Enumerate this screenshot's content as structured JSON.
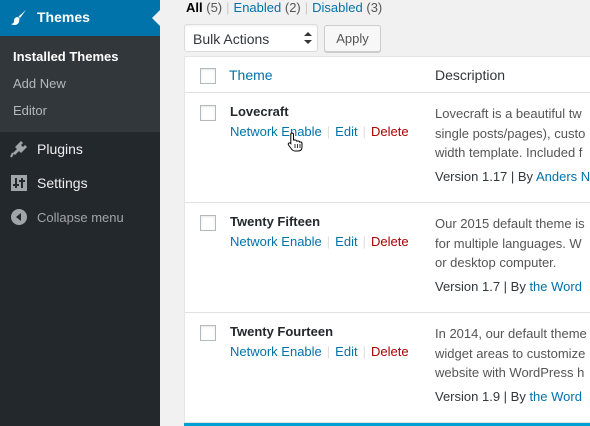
{
  "sidebar": {
    "active_menu": {
      "label": "Themes",
      "icon": "paintbrush-icon"
    },
    "submenu": [
      {
        "label": "Installed Themes",
        "current": true
      },
      {
        "label": "Add New",
        "current": false
      },
      {
        "label": "Editor",
        "current": false
      }
    ],
    "menu": [
      {
        "label": "Plugins",
        "icon": "plugin-icon"
      },
      {
        "label": "Settings",
        "icon": "settings-icon"
      },
      {
        "label": "Collapse menu",
        "icon": "collapse-icon"
      }
    ]
  },
  "filters": {
    "all": {
      "label": "All",
      "count": "(5)"
    },
    "enabled": {
      "label": "Enabled",
      "count": "(2)"
    },
    "disabled": {
      "label": "Disabled",
      "count": "(3)"
    },
    "separator": "|"
  },
  "bulk": {
    "selected": "Bulk Actions",
    "apply_label": "Apply"
  },
  "table": {
    "headers": {
      "theme": "Theme",
      "description": "Description"
    },
    "actions": {
      "network_enable": "Network Enable",
      "edit": "Edit",
      "delete": "Delete",
      "separator": "|"
    },
    "rows": [
      {
        "name": "Lovecraft",
        "description": [
          "Lovecraft is a beautiful tw",
          "single posts/pages), custo",
          "width template. Included f"
        ],
        "version": "Version 1.17 | By ",
        "author": "Anders N"
      },
      {
        "name": "Twenty Fifteen",
        "description": [
          "Our 2015 default theme is",
          "for multiple languages. W",
          "or desktop computer."
        ],
        "version": "Version 1.7 | By ",
        "author": "the Word"
      },
      {
        "name": "Twenty Fourteen",
        "description": [
          "In 2014, our default theme",
          "widget areas to customize",
          "website with WordPress h"
        ],
        "version": "Version 1.9 | By ",
        "author": "the Word"
      }
    ]
  },
  "colors": {
    "sidebar": "#23282d",
    "active": "#0073aa",
    "link": "#0073aa",
    "delete": "#a00"
  }
}
